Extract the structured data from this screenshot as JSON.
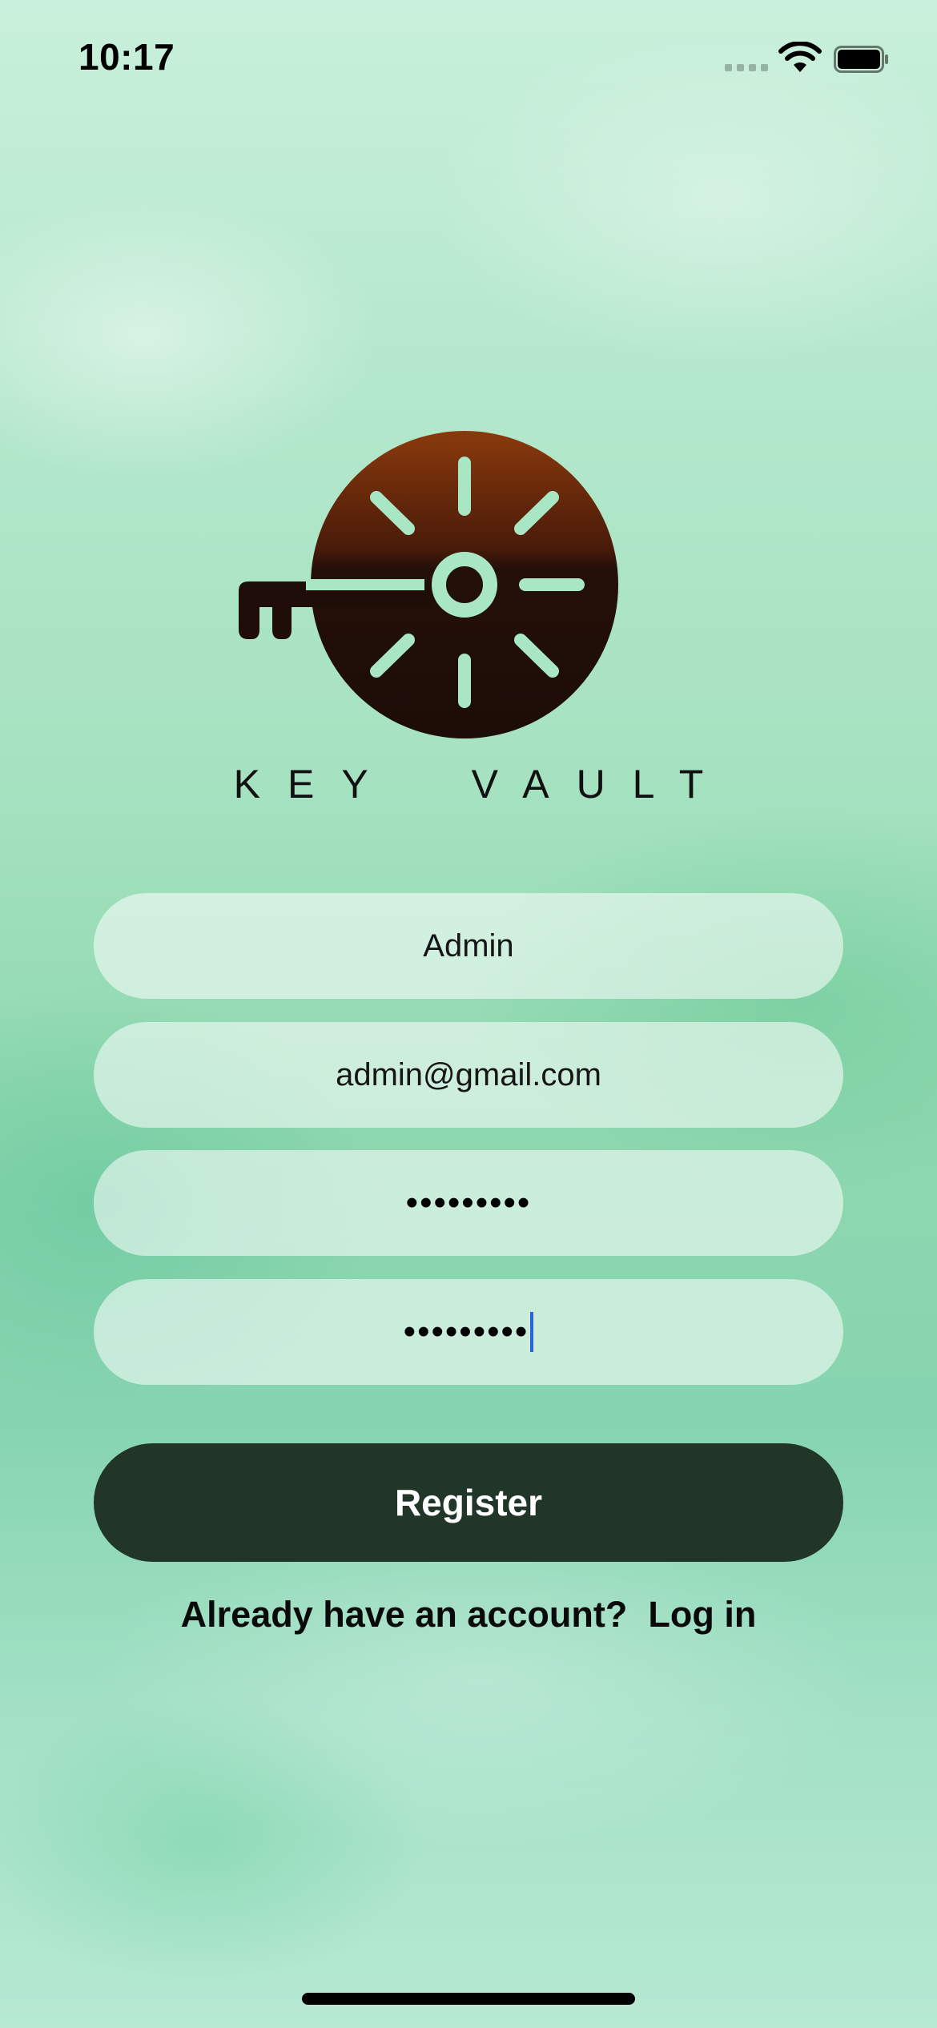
{
  "status_bar": {
    "time": "10:17",
    "icons": [
      "cellular-signal-icon",
      "wifi-icon",
      "battery-icon"
    ]
  },
  "logo": {
    "icon": "key-vault-logo-icon",
    "brand_name": "KEY  VAULT"
  },
  "form": {
    "name_value": "Admin",
    "email_value": "admin@gmail.com",
    "password_value": "•••••••••",
    "confirm_password_value": "•••••••••"
  },
  "actions": {
    "register_label": "Register",
    "login_prompt": "Already have an account?",
    "login_link": "Log in"
  },
  "colors": {
    "button": "#213528",
    "logo_top": "#7a3510",
    "logo_bottom": "#1e0d08",
    "logo_rays": "#a8e6c4",
    "caret": "#2a64e0"
  }
}
